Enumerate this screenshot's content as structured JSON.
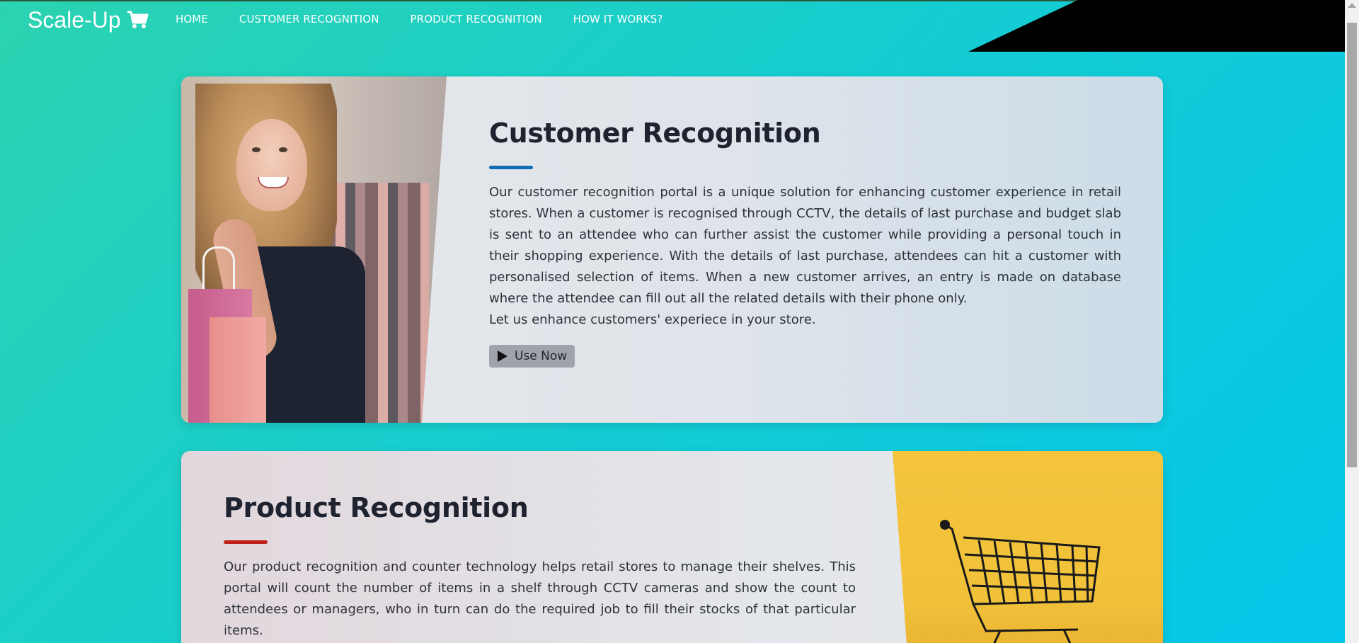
{
  "brand": {
    "name": "Scale-Up",
    "icon": "shopping-cart-icon"
  },
  "nav": {
    "items": [
      {
        "label": "HOME"
      },
      {
        "label": "CUSTOMER RECOGNITION"
      },
      {
        "label": "PRODUCT RECOGNITION"
      },
      {
        "label": "HOW IT WORKS?"
      }
    ]
  },
  "cards": [
    {
      "title": "Customer Recognition",
      "accent": "#0d6eb7",
      "description": "Our customer recognition portal is a unique solution for enhancing customer experience in retail stores. When a customer is recognised through CCTV, the details of last purchase and budget slab is sent to an attendee who can further assist the customer while providing a personal touch in their shopping experience. With the details of last purchase, attendees can hit a customer with personalised selection of items. When a new customer arrives, an entry is made on database where the attendee can fill out all the related details with their phone only.",
      "tagline": "Let us enhance customers' experiece in your store.",
      "button": {
        "label": "Use Now",
        "icon": "play-icon"
      },
      "image": "woman-with-shopping-bags"
    },
    {
      "title": "Product Recognition",
      "accent": "#c0201a",
      "description": "Our product recognition and counter technology helps retail stores to manage their shelves. This portal will count the number of items in a shelf through CCTV cameras and show the count to attendees or managers, who in turn can do the required job to fill their stocks of that particular items.",
      "image": "shopping-cart-on-yellow"
    }
  ],
  "colors": {
    "background_start": "#2bd3b0",
    "background_end": "#04c6ea",
    "button_bg": "#9ea4aa"
  }
}
